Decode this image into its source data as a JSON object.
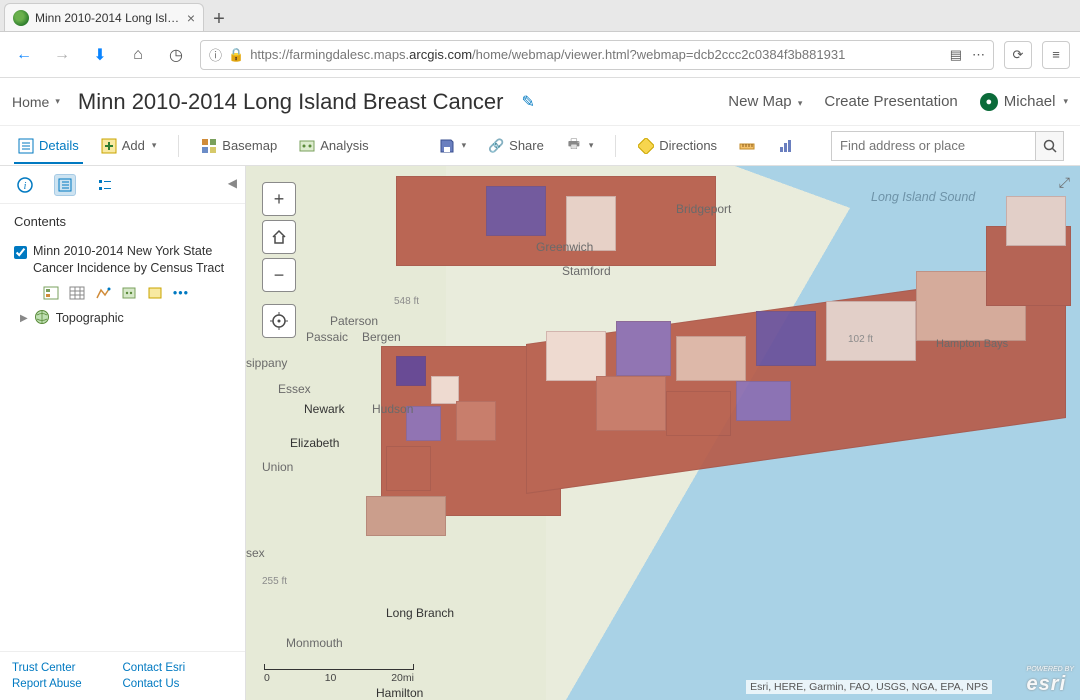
{
  "browser": {
    "tab_title": "Minn 2010-2014 Long Isl…",
    "url_display": {
      "prefix": "https://farmingdalesc.maps.",
      "host_strong": "arcgis.com",
      "path": "/home/webmap/viewer.html?webmap=dcb2ccc2c0384f3b881931"
    }
  },
  "header": {
    "home": "Home",
    "title": "Minn 2010-2014 Long Island Breast Cancer",
    "new_map": "New Map",
    "create_presentation": "Create Presentation",
    "user": "Michael"
  },
  "toolbar": {
    "details": "Details",
    "add": "Add",
    "basemap": "Basemap",
    "analysis": "Analysis",
    "share": "Share",
    "directions": "Directions",
    "search_placeholder": "Find address or place"
  },
  "sidebar": {
    "contents_title": "Contents",
    "layer1_label": "Minn 2010-2014 New York State Cancer Incidence by Census Tract",
    "layer2_label": "Topographic",
    "footer": {
      "trust": "Trust Center",
      "contact_esri": "Contact Esri",
      "report": "Report Abuse",
      "contact_us": "Contact Us"
    }
  },
  "map": {
    "water_label": "Long Island Sound",
    "cities": {
      "bridgeport": "Bridgeport",
      "greenwich": "Greenwich",
      "stamford": "Stamford",
      "paterson": "Paterson",
      "passaic": "Passaic",
      "bergen": "Bergen",
      "sippany": "sippany",
      "essex": "Essex",
      "newark": "Newark",
      "hudson": "Hudson",
      "elizabeth": "Elizabeth",
      "union": "Union",
      "middlesex": "sex",
      "monmouth": "Monmouth",
      "longbranch": "Long Branch",
      "hamilton": "Hamilton",
      "hampton": "Hampton Bays"
    },
    "elev": {
      "e548": "548 ft",
      "e255": "255 ft",
      "e102": "102 ft"
    },
    "scalebar": {
      "t0": "0",
      "t10": "10",
      "t20": "20mi"
    },
    "attribution": "Esri, HERE, Garmin, FAO, USGS, NGA, EPA, NPS",
    "esri_powered": "POWERED BY",
    "esri": "esri"
  }
}
